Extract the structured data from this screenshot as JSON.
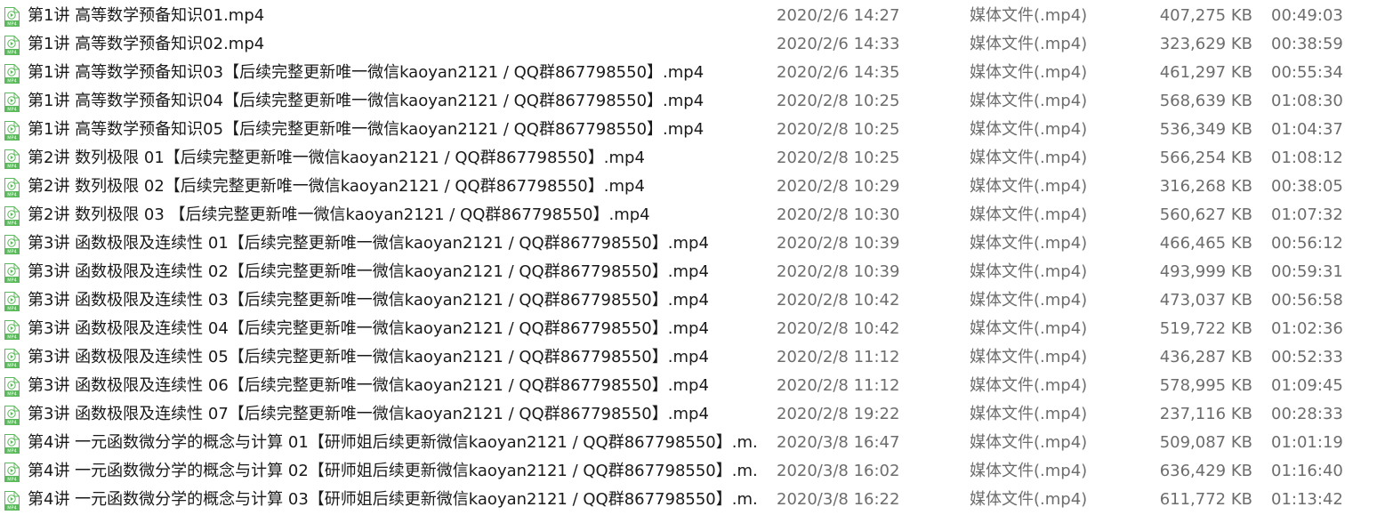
{
  "icon": {
    "name": "mp4-file-icon",
    "color": "#5cb85c",
    "badge_text": "MP4"
  },
  "files": [
    {
      "name": "第1讲 高等数学预备知识01.mp4",
      "modified": "2020/2/6 14:27",
      "type": "媒体文件(.mp4)",
      "size": "407,275 KB",
      "duration": "00:49:03"
    },
    {
      "name": "第1讲 高等数学预备知识02.mp4",
      "modified": "2020/2/6 14:33",
      "type": "媒体文件(.mp4)",
      "size": "323,629 KB",
      "duration": "00:38:59"
    },
    {
      "name": "第1讲 高等数学预备知识03【后续完整更新唯一微信kaoyan2121 / QQ群867798550】.mp4",
      "modified": "2020/2/6 14:35",
      "type": "媒体文件(.mp4)",
      "size": "461,297 KB",
      "duration": "00:55:34"
    },
    {
      "name": "第1讲 高等数学预备知识04【后续完整更新唯一微信kaoyan2121 / QQ群867798550】.mp4",
      "modified": "2020/2/8 10:25",
      "type": "媒体文件(.mp4)",
      "size": "568,639 KB",
      "duration": "01:08:30"
    },
    {
      "name": "第1讲 高等数学预备知识05【后续完整更新唯一微信kaoyan2121 / QQ群867798550】.mp4",
      "modified": "2020/2/8 10:25",
      "type": "媒体文件(.mp4)",
      "size": "536,349 KB",
      "duration": "01:04:37"
    },
    {
      "name": "第2讲 数列极限 01【后续完整更新唯一微信kaoyan2121 / QQ群867798550】.mp4",
      "modified": "2020/2/8 10:25",
      "type": "媒体文件(.mp4)",
      "size": "566,254 KB",
      "duration": "01:08:12"
    },
    {
      "name": "第2讲 数列极限 02【后续完整更新唯一微信kaoyan2121 / QQ群867798550】.mp4",
      "modified": "2020/2/8 10:29",
      "type": "媒体文件(.mp4)",
      "size": "316,268 KB",
      "duration": "00:38:05"
    },
    {
      "name": "第2讲 数列极限 03 【后续完整更新唯一微信kaoyan2121 / QQ群867798550】.mp4",
      "modified": "2020/2/8 10:30",
      "type": "媒体文件(.mp4)",
      "size": "560,627 KB",
      "duration": "01:07:32"
    },
    {
      "name": "第3讲 函数极限及连续性 01【后续完整更新唯一微信kaoyan2121 / QQ群867798550】.mp4",
      "modified": "2020/2/8 10:39",
      "type": "媒体文件(.mp4)",
      "size": "466,465 KB",
      "duration": "00:56:12"
    },
    {
      "name": "第3讲 函数极限及连续性 02【后续完整更新唯一微信kaoyan2121 / QQ群867798550】.mp4",
      "modified": "2020/2/8 10:39",
      "type": "媒体文件(.mp4)",
      "size": "493,999 KB",
      "duration": "00:59:31"
    },
    {
      "name": "第3讲 函数极限及连续性 03【后续完整更新唯一微信kaoyan2121 / QQ群867798550】.mp4",
      "modified": "2020/2/8 10:42",
      "type": "媒体文件(.mp4)",
      "size": "473,037 KB",
      "duration": "00:56:58"
    },
    {
      "name": "第3讲 函数极限及连续性 04【后续完整更新唯一微信kaoyan2121 / QQ群867798550】.mp4",
      "modified": "2020/2/8 10:42",
      "type": "媒体文件(.mp4)",
      "size": "519,722 KB",
      "duration": "01:02:36"
    },
    {
      "name": "第3讲 函数极限及连续性 05【后续完整更新唯一微信kaoyan2121 / QQ群867798550】.mp4",
      "modified": "2020/2/8 11:12",
      "type": "媒体文件(.mp4)",
      "size": "436,287 KB",
      "duration": "00:52:33"
    },
    {
      "name": "第3讲 函数极限及连续性 06【后续完整更新唯一微信kaoyan2121 / QQ群867798550】.mp4",
      "modified": "2020/2/8 11:12",
      "type": "媒体文件(.mp4)",
      "size": "578,995 KB",
      "duration": "01:09:45"
    },
    {
      "name": "第3讲 函数极限及连续性 07【后续完整更新唯一微信kaoyan2121 / QQ群867798550】.mp4",
      "modified": "2020/2/8 19:22",
      "type": "媒体文件(.mp4)",
      "size": "237,116 KB",
      "duration": "00:28:33"
    },
    {
      "name": "第4讲 一元函数微分学的概念与计算 01【研师姐后续更新微信kaoyan2121 / QQ群867798550】.m...",
      "modified": "2020/3/8 16:47",
      "type": "媒体文件(.mp4)",
      "size": "509,087 KB",
      "duration": "01:01:19"
    },
    {
      "name": "第4讲 一元函数微分学的概念与计算 02【研师姐后续更新微信kaoyan2121 / QQ群867798550】.m...",
      "modified": "2020/3/8 16:02",
      "type": "媒体文件(.mp4)",
      "size": "636,429 KB",
      "duration": "01:16:40"
    },
    {
      "name": "第4讲 一元函数微分学的概念与计算 03【研师姐后续更新微信kaoyan2121 / QQ群867798550】.m...",
      "modified": "2020/3/8 16:22",
      "type": "媒体文件(.mp4)",
      "size": "611,772 KB",
      "duration": "01:13:42"
    }
  ]
}
